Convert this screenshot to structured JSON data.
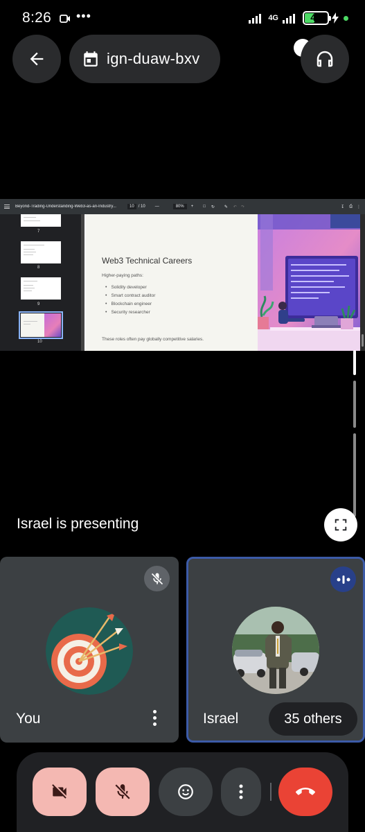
{
  "status_bar": {
    "time": "8:26",
    "network": "4G",
    "battery": "42",
    "battery_level": 0.42,
    "overflow": "•••"
  },
  "meeting": {
    "code": "ign-duaw-bxv"
  },
  "presentation": {
    "presenter_text": "Israel is presenting",
    "pdf": {
      "file_name": "Beyond-Trading-Understanding-Web3-as-an-Industry...",
      "page_current": "10",
      "page_total": "/ 10",
      "zoom": "80%",
      "thumbnails": [
        {
          "number": "7"
        },
        {
          "number": "8"
        },
        {
          "number": "9"
        },
        {
          "number": "10"
        }
      ]
    },
    "slide": {
      "title": "Web3 Technical Careers",
      "subtitle": "Higher-paying paths:",
      "items": [
        "Solidity developer",
        "Smart contract auditor",
        "Blockchain engineer",
        "Security researcher"
      ],
      "footer": "These roles often pay globally competitive salaries."
    }
  },
  "tiles": {
    "you": {
      "name": "You"
    },
    "israel": {
      "name": "Israel",
      "others": "35 others"
    }
  },
  "colors": {
    "tile_bg": "#3c4043",
    "active_border": "#3c5ba8",
    "end_call": "#ea4335",
    "muted_bg": "#f4b8b2"
  },
  "icons": {
    "back": "arrow-left-icon",
    "calendar": "calendar-icon",
    "audio": "headphones-icon",
    "fullscreen": "fullscreen-icon",
    "camera_off": "videocam-off-icon",
    "mic_off": "mic-off-icon",
    "emoji": "emoji-icon",
    "more": "more-vert-icon",
    "end_call": "call-end-icon"
  }
}
